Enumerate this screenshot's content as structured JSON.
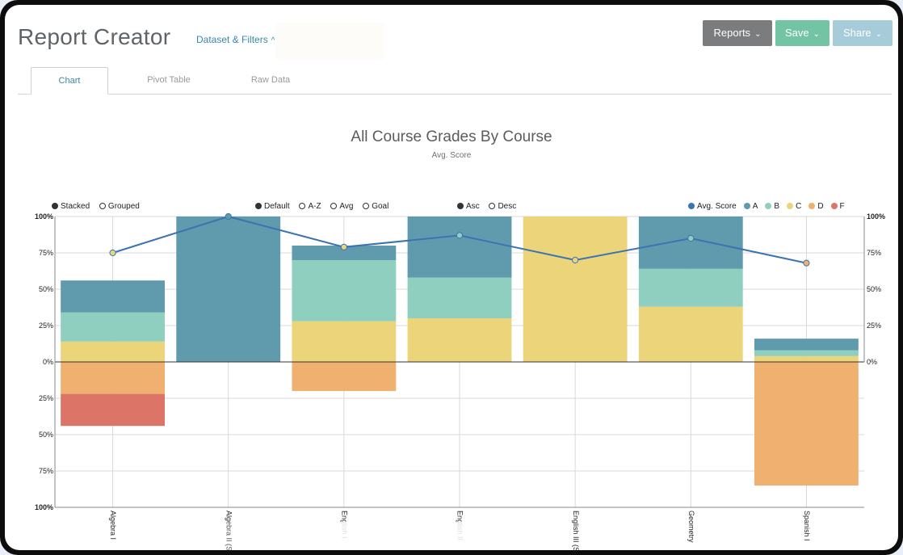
{
  "header": {
    "title": "Report Creator",
    "filters_link": "Dataset & Filters",
    "filters_chevron": "^",
    "buttons": [
      {
        "label": "Reports",
        "color": "#7b7c7d"
      },
      {
        "label": "Save",
        "color": "#73c4a4"
      },
      {
        "label": "Share",
        "color": "#a6ccd9"
      }
    ]
  },
  "tabs": [
    {
      "label": "Chart",
      "active": true
    },
    {
      "label": "Pivot Table",
      "active": false
    },
    {
      "label": "Raw Data",
      "active": false
    }
  ],
  "controls": {
    "layout": [
      {
        "label": "Stacked",
        "selected": true
      },
      {
        "label": "Grouped",
        "selected": false
      }
    ],
    "sort": [
      {
        "label": "Default",
        "selected": true
      },
      {
        "label": "A-Z",
        "selected": false
      },
      {
        "label": "Avg",
        "selected": false
      },
      {
        "label": "Goal",
        "selected": false
      }
    ],
    "order": [
      {
        "label": "Asc",
        "selected": true
      },
      {
        "label": "Desc",
        "selected": false
      }
    ]
  },
  "chart_data": {
    "type": "bar",
    "title": "All Course Grades By Course",
    "subtitle": "Avg. Score",
    "stacked": true,
    "categories": [
      "Algebra I",
      "Algebra II (S",
      "English I",
      "English II",
      "English III (S",
      "Geometry",
      "Spanish I"
    ],
    "y_ticks_left": [
      "100%",
      "75%",
      "50%",
      "25%",
      "0%",
      "25%",
      "50%",
      "75%",
      "100%"
    ],
    "y_ticks_right": [
      "100%",
      "75%",
      "50%",
      "25%",
      "0%"
    ],
    "ylim": [
      -100,
      100
    ],
    "grid": true,
    "legend_position": "top-right",
    "series": [
      {
        "name": "C",
        "color": "#ecd47a",
        "direction": "up",
        "values": [
          14,
          0,
          28,
          30,
          100,
          38,
          4
        ]
      },
      {
        "name": "B",
        "color": "#8fcfbf",
        "direction": "up",
        "values": [
          20,
          0,
          42,
          28,
          0,
          26,
          4
        ]
      },
      {
        "name": "A",
        "color": "#5f9bad",
        "direction": "up",
        "values": [
          22,
          100,
          10,
          42,
          0,
          36,
          8
        ]
      },
      {
        "name": "D",
        "color": "#f0b070",
        "direction": "down",
        "values": [
          22,
          0,
          20,
          0,
          0,
          0,
          85
        ]
      },
      {
        "name": "F",
        "color": "#dc7467",
        "direction": "down",
        "values": [
          22,
          0,
          0,
          0,
          0,
          0,
          0
        ]
      }
    ],
    "line": {
      "name": "Avg. Score",
      "color": "#3b74b0",
      "values": [
        75,
        100,
        79,
        87,
        70,
        85,
        68
      ],
      "point_colors": [
        "#ecd47a",
        "#5f9bad",
        "#ecd47a",
        "#8fcfbf",
        "#ecd47a",
        "#8fcfbf",
        "#f0b070"
      ]
    },
    "legend": [
      {
        "label": "Avg. Score",
        "color": "#3b74b0"
      },
      {
        "label": "A",
        "color": "#5f9bad"
      },
      {
        "label": "B",
        "color": "#8fcfbf"
      },
      {
        "label": "C",
        "color": "#ecd47a"
      },
      {
        "label": "D",
        "color": "#f0b070"
      },
      {
        "label": "F",
        "color": "#dc7467"
      }
    ]
  }
}
